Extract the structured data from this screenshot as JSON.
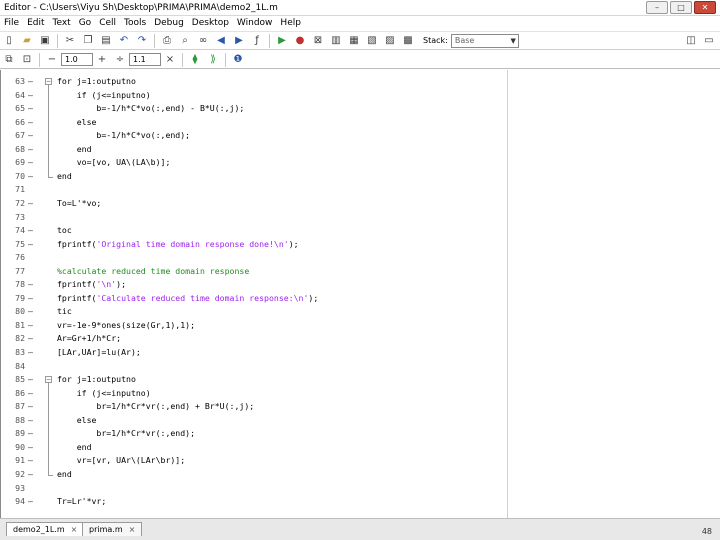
{
  "window": {
    "title": "Editor - C:\\Users\\Viyu Sh\\Desktop\\PRIMA\\PRIMA\\demo2_1L.m",
    "controls": [
      "–",
      "□",
      "✕"
    ]
  },
  "menu": [
    "File",
    "Edit",
    "Text",
    "Go",
    "Cell",
    "Tools",
    "Debug",
    "Desktop",
    "Window",
    "Help"
  ],
  "toolbar": {
    "stack_label": "Stack:",
    "stack_value": "Base"
  },
  "cell_toolbar": {
    "minus_label": "−",
    "value": "1.0",
    "plus_label": "+",
    "divide_label": "÷",
    "value2": "1.1",
    "times_label": "×"
  },
  "code_lines": [
    {
      "n": "63",
      "dash": "—",
      "text": "for j=1:outputno"
    },
    {
      "n": "64",
      "dash": "—",
      "text": "    if (j<=inputno)"
    },
    {
      "n": "65",
      "dash": "—",
      "text": "        b=-1/h*C*vo(:,end) - B*U(:,j);"
    },
    {
      "n": "66",
      "dash": "—",
      "text": "    else"
    },
    {
      "n": "67",
      "dash": "—",
      "text": "        b=-1/h*C*vo(:,end);"
    },
    {
      "n": "68",
      "dash": "—",
      "text": "    end"
    },
    {
      "n": "69",
      "dash": "—",
      "text": "    vo=[vo, UA\\(LA\\b)];"
    },
    {
      "n": "70",
      "dash": "—",
      "text": "end"
    },
    {
      "n": "71",
      "dash": "",
      "text": ""
    },
    {
      "n": "72",
      "dash": "—",
      "text": "To=L'*vo;"
    },
    {
      "n": "73",
      "dash": "",
      "text": ""
    },
    {
      "n": "74",
      "dash": "—",
      "text": "toc"
    },
    {
      "n": "75",
      "dash": "—",
      "text": "fprintf('Original time domain response done!\\n');"
    },
    {
      "n": "76",
      "dash": "",
      "text": ""
    },
    {
      "n": "77",
      "dash": "",
      "text": "%calculate reduced time domain response"
    },
    {
      "n": "78",
      "dash": "—",
      "text": "fprintf('\\n');"
    },
    {
      "n": "79",
      "dash": "—",
      "text": "fprintf('Calculate reduced time domain response:\\n');"
    },
    {
      "n": "80",
      "dash": "—",
      "text": "tic"
    },
    {
      "n": "81",
      "dash": "—",
      "text": "vr=-1e-9*ones(size(Gr,1),1);"
    },
    {
      "n": "82",
      "dash": "—",
      "text": "Ar=Gr+1/h*Cr;"
    },
    {
      "n": "83",
      "dash": "—",
      "text": "[LAr,UAr]=lu(Ar);"
    },
    {
      "n": "84",
      "dash": "",
      "text": ""
    },
    {
      "n": "85",
      "dash": "—",
      "text": "for j=1:outputno"
    },
    {
      "n": "86",
      "dash": "—",
      "text": "    if (j<=inputno)"
    },
    {
      "n": "87",
      "dash": "—",
      "text": "        br=1/h*Cr*vr(:,end) + Br*U(:,j);"
    },
    {
      "n": "88",
      "dash": "—",
      "text": "    else"
    },
    {
      "n": "89",
      "dash": "—",
      "text": "        br=1/h*Cr*vr(:,end);"
    },
    {
      "n": "90",
      "dash": "—",
      "text": "    end"
    },
    {
      "n": "91",
      "dash": "—",
      "text": "    vr=[vr, UAr\\(LAr\\br)];"
    },
    {
      "n": "92",
      "dash": "—",
      "text": "end"
    },
    {
      "n": "93",
      "dash": "",
      "text": ""
    },
    {
      "n": "94",
      "dash": "—",
      "text": "Tr=Lr'*vr;"
    }
  ],
  "tabs": [
    {
      "label": "demo2_1L.m",
      "close": "×"
    },
    {
      "label": "prima.m",
      "close": "×"
    }
  ],
  "status": {
    "line_number": "48"
  },
  "colors": {
    "string": "#a020f0",
    "comment": "#228b22",
    "keyword": "#0000ff"
  }
}
